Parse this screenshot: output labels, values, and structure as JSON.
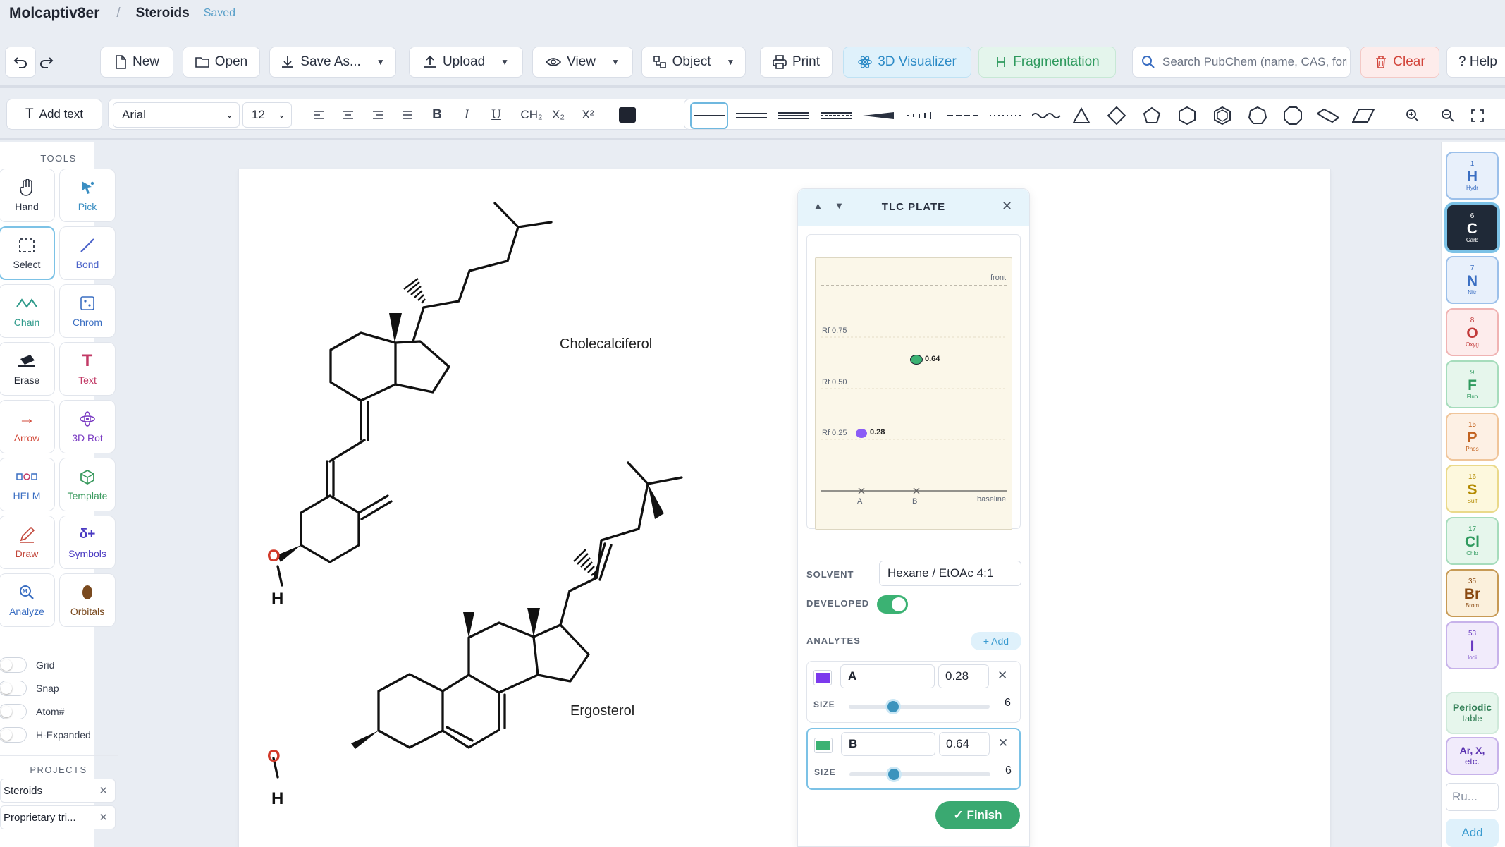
{
  "header": {
    "app_name": "Molcaptiv8er",
    "separator": "/",
    "doc_title": "Steroids",
    "status": "Saved"
  },
  "toolbar": {
    "new": "New",
    "open": "Open",
    "save_as": "Save As...",
    "upload": "Upload",
    "view": "View",
    "object": "Object",
    "print": "Print",
    "visualizer": "3D Visualizer",
    "fragmentation": "Fragmentation",
    "search_placeholder": "Search PubChem (name, CAS, formula)",
    "clear": "Clear",
    "help": "? Help"
  },
  "format": {
    "add_text": "Add text",
    "font": "Arial",
    "font_size": "12",
    "bold": "B",
    "italic": "I",
    "underline": "U",
    "ch2": "CH₂",
    "sub": "X₂",
    "sup": "X²",
    "text_color": "#1f2430"
  },
  "tools": {
    "heading": "TOOLS",
    "items": [
      {
        "label": "Hand",
        "icon": "hand-icon",
        "color": "#2a3140"
      },
      {
        "label": "Pick",
        "icon": "pointer-icon",
        "color": "#3a8ec2"
      },
      {
        "label": "Select",
        "icon": "marquee-icon",
        "color": "#2a3140"
      },
      {
        "label": "Bond",
        "icon": "bond-line-icon",
        "color": "#4b63c9"
      },
      {
        "label": "Chain",
        "icon": "zigzag-icon",
        "color": "#2e9a8a"
      },
      {
        "label": "Chrom",
        "icon": "dice-icon",
        "color": "#3a6ec2"
      },
      {
        "label": "Erase",
        "icon": "eraser-icon",
        "color": "#1f2430"
      },
      {
        "label": "Text",
        "icon": "text-t-icon",
        "color": "#c23a66"
      },
      {
        "label": "Arrow",
        "icon": "arrow-icon",
        "color": "#d24a3a"
      },
      {
        "label": "3D Rot",
        "icon": "orbit-icon",
        "color": "#7a3ac2"
      },
      {
        "label": "HELM",
        "icon": "helm-icon",
        "color": "#3a6ec2"
      },
      {
        "label": "Template",
        "icon": "cube-icon",
        "color": "#3a9a5e"
      },
      {
        "label": "Draw",
        "icon": "pen-icon",
        "color": "#c2463a"
      },
      {
        "label": "Symbols",
        "icon": "symbols-icon",
        "color": "#4a3ac2"
      },
      {
        "label": "Analyze",
        "icon": "magnifier-icon",
        "color": "#3a6ec2"
      },
      {
        "label": "Orbitals",
        "icon": "orbital-icon",
        "color": "#7a4a1f"
      }
    ],
    "toggles": [
      "Grid",
      "Snap",
      "Atom#",
      "H-Expanded"
    ],
    "projects_heading": "PROJECTS",
    "projects": [
      "Steroids",
      "Proprietary tri..."
    ]
  },
  "canvas": {
    "molecule_1": "Cholecalciferol",
    "molecule_2": "Ergosterol",
    "atom_o": "O",
    "atom_h": "H"
  },
  "tlc": {
    "title": "TLC PLATE",
    "front_label": "front",
    "baseline_label": "baseline",
    "rf_labels": [
      "Rf 0.75",
      "Rf 0.50",
      "Rf 0.25"
    ],
    "lane_a": "A",
    "lane_b": "B",
    "spot_a_label": "0.28",
    "spot_b_label": "0.64",
    "solvent_label": "SOLVENT",
    "solvent": "Hexane / EtOAc 4:1",
    "developed_label": "DEVELOPED",
    "developed": true,
    "analytes_label": "ANALYTES",
    "add_label": "+ Add",
    "analytes": [
      {
        "name": "A",
        "rf": "0.28",
        "color": "#7c3aed",
        "size_label": "SIZE",
        "size": "6"
      },
      {
        "name": "B",
        "rf": "0.64",
        "color": "#3bb273",
        "size_label": "SIZE",
        "size": "6"
      }
    ],
    "finish": "✓ Finish"
  },
  "elements": [
    {
      "num": "1",
      "sym": "H",
      "name": "Hydr",
      "color": "#3a6ec2",
      "bg": "#e8f0fb",
      "border": "#9cc0ea"
    },
    {
      "num": "6",
      "sym": "C",
      "name": "Carb",
      "color": "#ffffff",
      "bg": "#1f2937",
      "border": "#7cc2e6"
    },
    {
      "num": "7",
      "sym": "N",
      "name": "Nitr",
      "color": "#3a6ec2",
      "bg": "#e8f0fb",
      "border": "#9cc0ea"
    },
    {
      "num": "8",
      "sym": "O",
      "name": "Oxyg",
      "color": "#c23a3a",
      "bg": "#fdecec",
      "border": "#f0b3b3"
    },
    {
      "num": "9",
      "sym": "F",
      "name": "Fluo",
      "color": "#2f9a5e",
      "bg": "#e6f6ec",
      "border": "#a6dcbc"
    },
    {
      "num": "15",
      "sym": "P",
      "name": "Phos",
      "color": "#c2621f",
      "bg": "#fdf0e4",
      "border": "#f0c59a"
    },
    {
      "num": "16",
      "sym": "S",
      "name": "Sulf",
      "color": "#b38a00",
      "bg": "#fdf8dd",
      "border": "#ead98a"
    },
    {
      "num": "17",
      "sym": "Cl",
      "name": "Chlo",
      "color": "#2f9a5e",
      "bg": "#e6f6ec",
      "border": "#a6dcbc"
    },
    {
      "num": "35",
      "sym": "Br",
      "name": "Brom",
      "color": "#8a4a12",
      "bg": "#fbf0dc",
      "border": "#c79a55"
    },
    {
      "num": "53",
      "sym": "I",
      "name": "Iodi",
      "color": "#6a3ac2",
      "bg": "#f1ebfb",
      "border": "#c7b2ea"
    }
  ],
  "side": {
    "periodic_1": "Periodic",
    "periodic_2": "table",
    "arx_1": "Ar, X,",
    "arx_2": "etc.",
    "rule_placeholder": "Ru...",
    "add": "Add"
  }
}
